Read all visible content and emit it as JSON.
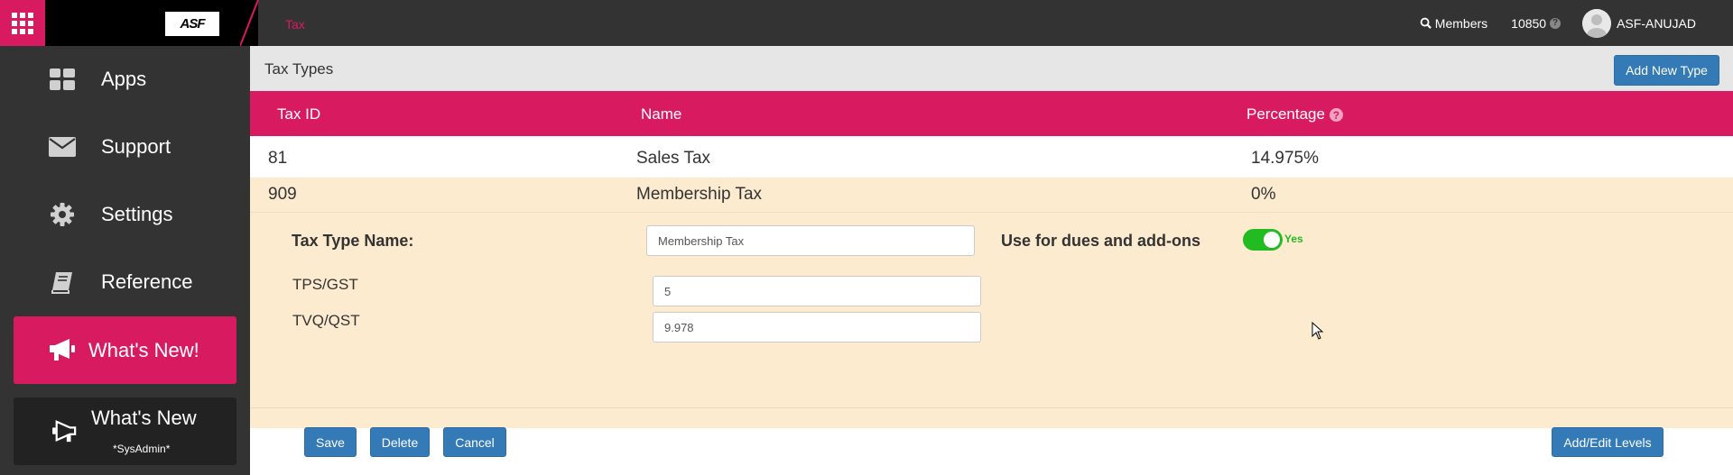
{
  "topbar": {
    "logo_text": "ASF",
    "breadcrumb": "Tax",
    "members_label": "Members",
    "member_count": "10850",
    "help_icon_text": "?",
    "username": "ASF-ANUJAD"
  },
  "sidebar": {
    "items": [
      {
        "label": "Apps",
        "icon": "apps-grid-icon"
      },
      {
        "label": "Support",
        "icon": "envelope-icon"
      },
      {
        "label": "Settings",
        "icon": "gear-icon"
      },
      {
        "label": "Reference",
        "icon": "book-icon"
      }
    ],
    "whats_new": {
      "label": "What's New!",
      "icon": "megaphone-icon"
    },
    "whats_new_admin": {
      "label": "What's New",
      "sublabel": "*SysAdmin*",
      "icon": "megaphone-icon"
    }
  },
  "panel": {
    "title": "Tax Types",
    "add_button": "Add New Type"
  },
  "table": {
    "headers": {
      "tax_id": "Tax ID",
      "name": "Name",
      "percentage": "Percentage",
      "help": "?"
    },
    "rows": [
      {
        "id": "81",
        "name": "Sales Tax",
        "percentage": "14.975%"
      },
      {
        "id": "909",
        "name": "Membership Tax",
        "percentage": "0%"
      }
    ]
  },
  "edit": {
    "name_label": "Tax Type Name:",
    "name_value": "Membership Tax",
    "dues_label": "Use for dues and add-ons",
    "toggle_label": "Yes",
    "toggle_on": true,
    "gst_label": "TPS/GST",
    "gst_value": "5",
    "qst_label": "TVQ/QST",
    "qst_value": "9.978",
    "save": "Save",
    "delete": "Delete",
    "cancel": "Cancel",
    "levels": "Add/Edit Levels"
  },
  "colors": {
    "accent": "#d81b60",
    "primary_button": "#337ab7",
    "selected_row": "#fdebd0",
    "toggle_on": "#22bb22",
    "dark": "#333333"
  }
}
